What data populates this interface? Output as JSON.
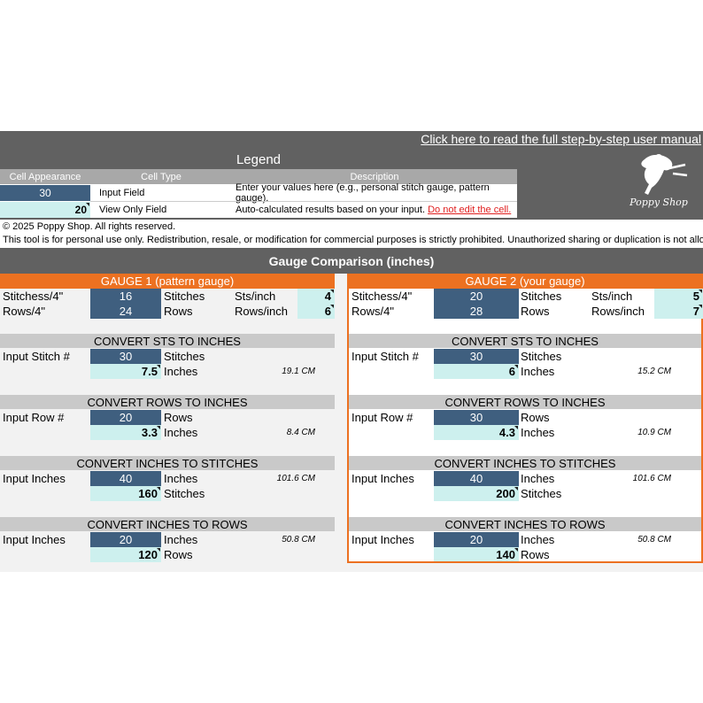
{
  "header": {
    "manual_link": "Click here to read the full step-by-step user manual",
    "legend_title": "Legend",
    "logo_text": "Poppy Shop"
  },
  "legend": {
    "col_appearance": "Cell Appearance",
    "col_type": "Cell Type",
    "col_description": "Description",
    "rows": [
      {
        "value": "30",
        "type": "Input Field",
        "description": "Enter your values here (e.g., personal stitch gauge, pattern gauge).",
        "warning": ""
      },
      {
        "value": "20",
        "type": "View Only Field",
        "description": "Auto-calculated results based on your input.",
        "warning": "Do not edit the cell."
      }
    ]
  },
  "notice": {
    "copyright": "© 2025 Poppy Shop. All rights reserved.",
    "terms": "This tool is for personal use only. Redistribution, resale, or modification for commercial purposes is strictly prohibited. Unauthorized sharing or duplication is not allowed."
  },
  "comparison_title": "Gauge Comparison (inches)",
  "labels": {
    "stitches_per_4": "Stitchess/4\"",
    "rows_per_4": "Rows/4\"",
    "stitches": "Stitches",
    "rows": "Rows",
    "sts_inch": "Sts/inch",
    "rows_inch": "Rows/inch",
    "inches": "Inches",
    "input_stitch": "Input Stitch #",
    "input_row": "Input Row #",
    "input_inches": "Input Inches",
    "conv_sts_in": "CONVERT STS TO INCHES",
    "conv_rows_in": "CONVERT ROWS TO INCHES",
    "conv_in_sts": "CONVERT INCHES TO STITCHES",
    "conv_in_rows": "CONVERT INCHES TO ROWS"
  },
  "gauge1": {
    "title": "GAUGE 1 (pattern gauge)",
    "stitches_4": "16",
    "rows_4": "24",
    "sts_inch": "4",
    "rows_inch": "6",
    "sts_to_in": {
      "input": "30",
      "result": "7.5",
      "cm": "19.1  CM"
    },
    "rows_to_in": {
      "input": "20",
      "result": "3.3",
      "cm": "8.4  CM"
    },
    "in_to_sts": {
      "input": "40",
      "result": "160",
      "cm": "101.6  CM"
    },
    "in_to_rows": {
      "input": "20",
      "result": "120",
      "cm": "50.8  CM"
    }
  },
  "gauge2": {
    "title": "GAUGE 2 (your gauge)",
    "stitches_4": "20",
    "rows_4": "28",
    "sts_inch": "5",
    "rows_inch": "7",
    "sts_to_in": {
      "input": "30",
      "result": "6",
      "cm": "15.2  CM"
    },
    "rows_to_in": {
      "input": "30",
      "result": "4.3",
      "cm": "10.9  CM"
    },
    "in_to_sts": {
      "input": "40",
      "result": "200",
      "cm": "101.6  CM"
    },
    "in_to_rows": {
      "input": "20",
      "result": "140",
      "cm": "50.8  CM"
    }
  },
  "colors": {
    "dark_bg": "#616161",
    "input_cell": "#3f5f7f",
    "view_cell": "#cdf0ee",
    "accent": "#ec7121",
    "warning": "#e02020"
  }
}
